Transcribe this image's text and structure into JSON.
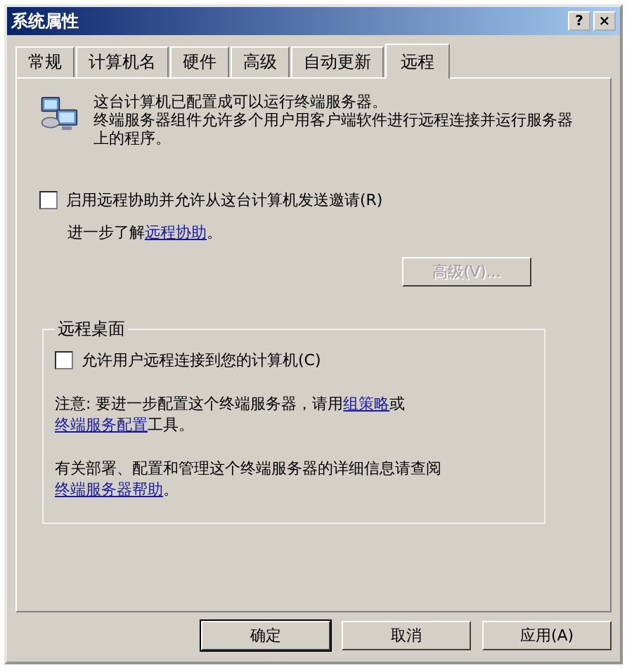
{
  "window": {
    "title": "系统属性",
    "help": "?",
    "close": "×"
  },
  "tabs": [
    {
      "label": "常规",
      "selected": false
    },
    {
      "label": "计算机名",
      "selected": false
    },
    {
      "label": "硬件",
      "selected": false
    },
    {
      "label": "高级",
      "selected": false
    },
    {
      "label": "自动更新",
      "selected": false
    },
    {
      "label": "远程",
      "selected": true
    }
  ],
  "intro": [
    "这台计算机已配置成可以运行终端服务器。",
    "终端服务器组件允许多个用户用客户端软件进行远程连接并运行服务器上的程序。"
  ],
  "remote_assistance": {
    "checkbox": {
      "label": "启用远程协助并允许从这台计算机发送邀请(R)",
      "checked": false
    },
    "learn_more": [
      [
        {
          "kind": "text",
          "text": "进一步了解"
        },
        {
          "kind": "link",
          "text": "远程协助"
        },
        {
          "kind": "text",
          "text": "。"
        }
      ]
    ],
    "advanced_button": {
      "label": "高级(V)...",
      "disabled": true
    }
  },
  "remote_desktop": {
    "title": "远程桌面",
    "checkbox": {
      "label": "允许用户远程连接到您的计算机(C)",
      "checked": false
    },
    "notes": [
      [
        [
          {
            "kind": "text",
            "text": "注意: 要进一步配置这个终端服务器，请用"
          },
          {
            "kind": "link",
            "text": "组策略"
          },
          {
            "kind": "text",
            "text": "或"
          }
        ],
        [
          {
            "kind": "link",
            "text": "终端服务配置"
          },
          {
            "kind": "text",
            "text": "工具。"
          }
        ]
      ],
      [
        [
          {
            "kind": "text",
            "text": "有关部署、配置和管理这个终端服务器的详细信息请查阅"
          }
        ],
        [
          {
            "kind": "link",
            "text": "终端服务器帮助"
          },
          {
            "kind": "text",
            "text": "。"
          }
        ]
      ]
    ]
  },
  "buttons": [
    {
      "label": "确定",
      "default": true
    },
    {
      "label": "取消",
      "default": false
    },
    {
      "label": "应用(A)",
      "default": false
    }
  ]
}
